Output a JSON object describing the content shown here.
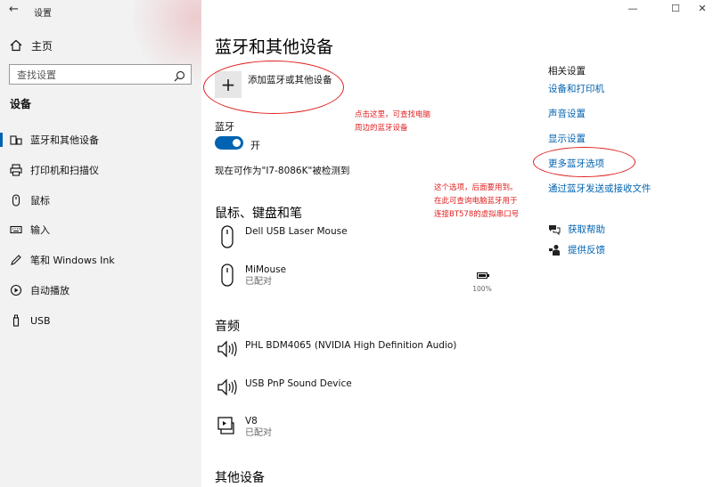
{
  "app": {
    "title": "设置",
    "back_icon": "back-arrow-icon"
  },
  "window_controls": {
    "minimize": "—",
    "maximize": "☐",
    "close": "✕"
  },
  "sidebar": {
    "home_label": "主页",
    "search_placeholder": "查找设置",
    "section_title": "设备",
    "items": [
      {
        "label": "蓝牙和其他设备",
        "icon": "bluetooth-devices-icon",
        "active": true
      },
      {
        "label": "打印机和扫描仪",
        "icon": "printer-icon"
      },
      {
        "label": "鼠标",
        "icon": "mouse-icon"
      },
      {
        "label": "输入",
        "icon": "keyboard-icon"
      },
      {
        "label": "笔和 Windows Ink",
        "icon": "pen-icon"
      },
      {
        "label": "自动播放",
        "icon": "autoplay-icon"
      },
      {
        "label": "USB",
        "icon": "usb-icon"
      }
    ]
  },
  "main": {
    "title": "蓝牙和其他设备",
    "add_device_label": "添加蓝牙或其他设备",
    "bluetooth_label": "蓝牙",
    "bluetooth_state": "开",
    "bluetooth_on": true,
    "discoverable_text": "现在可作为\"I7-8086K\"被检测到",
    "mouse_section": {
      "title": "鼠标、键盘和笔",
      "devices": [
        {
          "name": "Dell USB Laser Mouse",
          "status": "",
          "icon": "mouse-icon"
        },
        {
          "name": "MiMouse",
          "status": "已配对",
          "icon": "mouse-icon",
          "battery": "100%"
        }
      ]
    },
    "audio_section": {
      "title": "音频",
      "devices": [
        {
          "name": "PHL BDM4065 (NVIDIA High Definition Audio)",
          "status": "",
          "icon": "speaker-icon"
        },
        {
          "name": "USB PnP Sound Device",
          "status": "",
          "icon": "speaker-icon"
        },
        {
          "name": "V8",
          "status": "已配对",
          "icon": "media-device-icon"
        }
      ]
    },
    "other_section": {
      "title": "其他设备"
    }
  },
  "related": {
    "title": "相关设置",
    "links": [
      "设备和打印机",
      "声音设置",
      "显示设置",
      "更多蓝牙选项",
      "通过蓝牙发送或接收文件"
    ],
    "help": "获取帮助",
    "feedback": "提供反馈"
  },
  "annotations": {
    "note1_line1": "点击这里，可查找电脑",
    "note1_line2": "周边的蓝牙设备",
    "note2_line1": "这个选项，后面要用到。",
    "note2_line2": "在此可查询电脑蓝牙用于",
    "note2_line3": "连接BT578的虚拟串口号",
    "color": "#e02020"
  },
  "colors": {
    "accent": "#0063b1",
    "sidebar_bg": "#f2f2f2",
    "annotation": "#e02020"
  }
}
